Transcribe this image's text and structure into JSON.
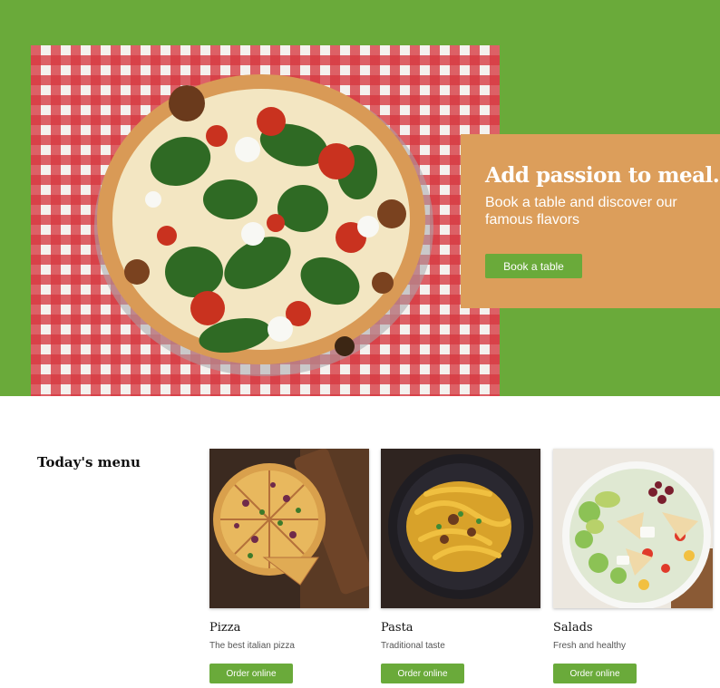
{
  "colors": {
    "brand_green": "#6aaa3a",
    "promo_orange": "#dc9e5b",
    "tablecloth_red": "#d63840"
  },
  "hero": {
    "image_icon": "pizza-on-checkered-tablecloth",
    "promo": {
      "title": "Add passion to meal.",
      "subtitle": "Book a table and discover our famous flavors",
      "button_label": "Book a table"
    }
  },
  "menu": {
    "heading": "Today's menu",
    "items": [
      {
        "name": "Pizza",
        "description": "The best italian pizza",
        "button_label": "Order online",
        "photo_icon": "pizza-photo"
      },
      {
        "name": "Pasta",
        "description": "Traditional taste",
        "button_label": "Order online",
        "photo_icon": "pasta-photo"
      },
      {
        "name": "Salads",
        "description": "Fresh and healthy",
        "button_label": "Order online",
        "photo_icon": "salad-photo"
      }
    ]
  }
}
